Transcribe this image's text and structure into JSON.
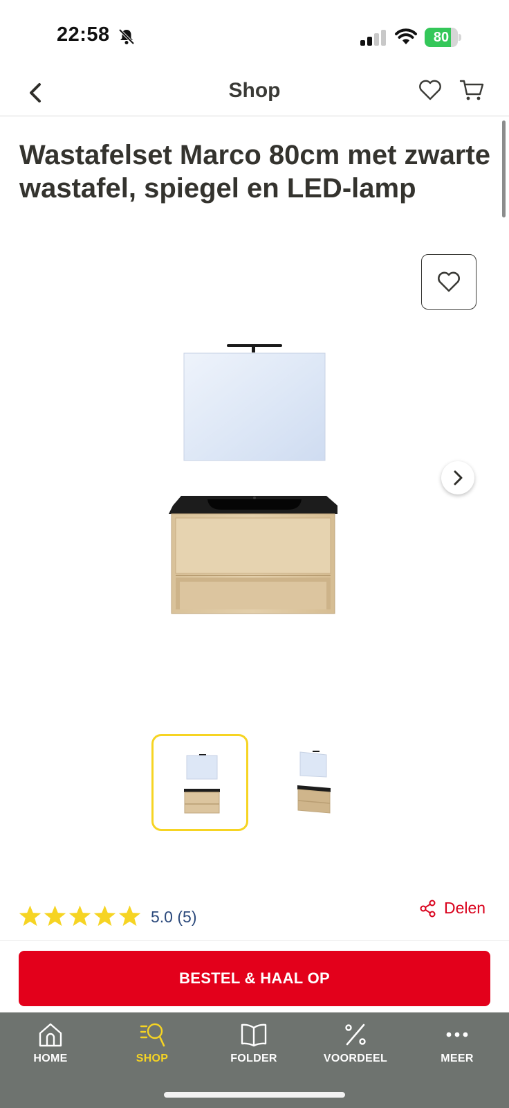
{
  "status_bar": {
    "time": "22:58",
    "battery_percent": "80",
    "battery_level": 0.8,
    "icons": [
      "bell-slash-icon",
      "signal-icon",
      "wifi-icon",
      "battery-icon"
    ]
  },
  "header": {
    "title": "Shop",
    "icons": [
      "chevron-left-icon",
      "heart-icon",
      "cart-icon"
    ]
  },
  "product": {
    "title": "Wastafelset Marco 80cm met zwarte wastafel, spiegel en LED-lamp",
    "rating": 5.0,
    "rating_text": "5.0 (5)",
    "stars_filled": 5,
    "share_label": "Delen",
    "thumbnails_count": 2,
    "selected_thumbnail": 1
  },
  "cta": {
    "label": "BESTEL & HAAL OP"
  },
  "bottom_nav": {
    "items": [
      {
        "label": "HOME",
        "icon": "home-icon"
      },
      {
        "label": "SHOP",
        "icon": "shop-search-icon",
        "active": true
      },
      {
        "label": "FOLDER",
        "icon": "book-icon"
      },
      {
        "label": "VOORDEEL",
        "icon": "percent-icon"
      },
      {
        "label": "MEER",
        "icon": "more-dots-icon"
      }
    ]
  },
  "colors": {
    "accent_red": "#e3001b",
    "accent_yellow": "#f6d423",
    "nav_background": "#6e736f",
    "rating_text": "#2c4a7c"
  }
}
